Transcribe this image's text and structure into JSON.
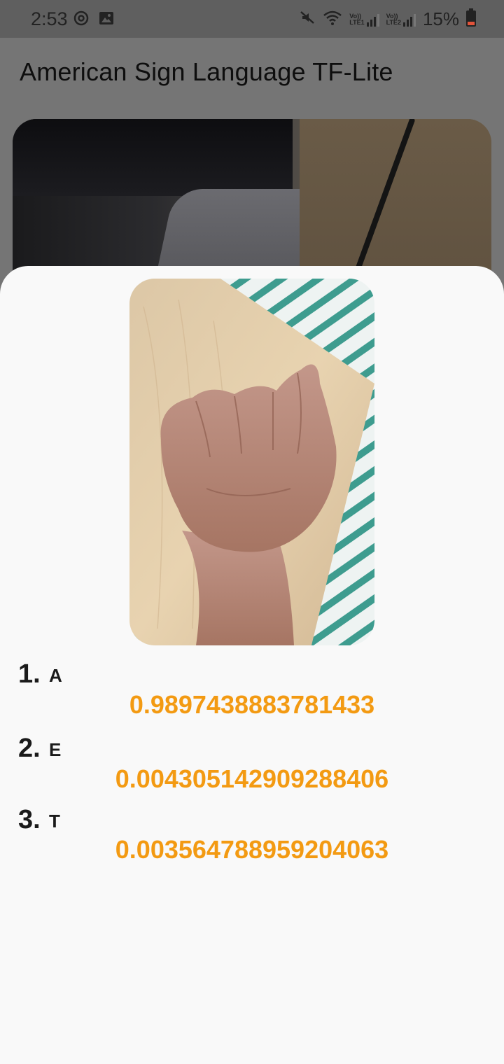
{
  "status_bar": {
    "time": "2:53",
    "left_icons": [
      "sync-icon",
      "gallery-icon"
    ],
    "right_icons": [
      "mute-icon",
      "wifi-icon",
      "signal-lte1-icon",
      "signal-lte2-icon",
      "battery-icon"
    ],
    "lte1_label": "Vo))\nLTE1",
    "lte2_label": "Vo))\nLTE2",
    "battery_text": "15%"
  },
  "app_bar": {
    "title": "American Sign Language TF-Lite"
  },
  "results": [
    {
      "index": "1.",
      "label": "A",
      "score": "0.9897438883781433"
    },
    {
      "index": "2.",
      "label": "E",
      "score": "0.004305142909288406"
    },
    {
      "index": "3.",
      "label": "T",
      "score": "0.003564788959204063"
    }
  ],
  "colors": {
    "score": "#f39a12",
    "sheet_background": "#f9f9f9",
    "scrim": "#757575",
    "battery_low": "#e2533a"
  }
}
